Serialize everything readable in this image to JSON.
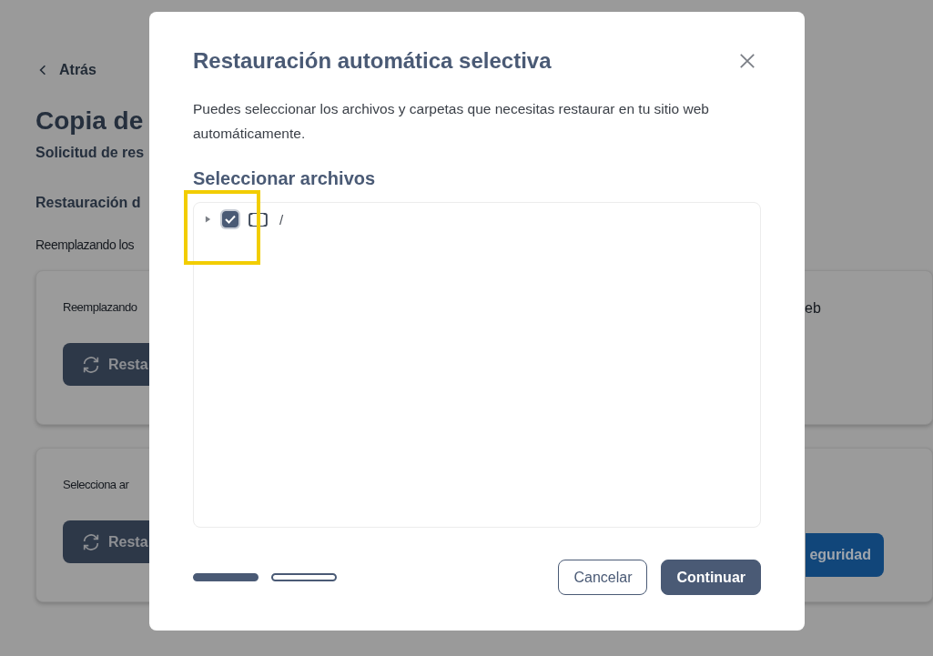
{
  "page": {
    "back_link": "Atrás",
    "title": "Copia de",
    "subtitle": "Solicitud de res",
    "section_title": "Restauración d",
    "intro": "Reemplazando los",
    "cards": [
      {
        "text": "Reemplazando",
        "text_right": "eb",
        "button": "Resta"
      },
      {
        "text": "Selecciona ar",
        "button": "Resta",
        "button_right": "eguridad"
      }
    ]
  },
  "dialog": {
    "title": "Restauración automática selectiva",
    "description": "Puedes seleccionar los archivos y carpetas que necesitas restaurar en tu sitio web automáticamente.",
    "section_title": "Seleccionar archivos",
    "tree": [
      {
        "label": "/",
        "expanded": false,
        "checked": true,
        "highlighted": true
      }
    ],
    "steps": [
      {
        "active": true
      },
      {
        "active": false
      }
    ],
    "buttons": {
      "cancel": "Cancelar",
      "continue": "Continuar"
    }
  }
}
